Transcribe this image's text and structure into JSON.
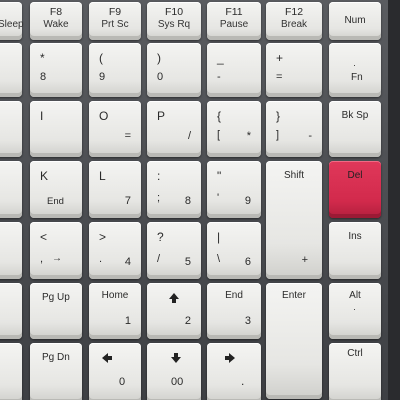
{
  "keys": {
    "f7": {
      "sub": "Sleep"
    },
    "f8": {
      "top": "F8",
      "sub": "Wake"
    },
    "f9": {
      "top": "F9",
      "sub": "Prt Sc"
    },
    "f10": {
      "top": "F10",
      "sub": "Sys Rq"
    },
    "f11": {
      "top": "F11",
      "sub": "Pause"
    },
    "f12": {
      "top": "F12",
      "sub": "Break"
    },
    "num": {
      "label": "Num"
    },
    "k8": {
      "shift": "*",
      "base": "8"
    },
    "k9": {
      "shift": "(",
      "base": "9"
    },
    "k0": {
      "shift": ")",
      "base": "0"
    },
    "minus": {
      "shift": "_",
      "base": "-"
    },
    "plus": {
      "shift": "+",
      "base": "="
    },
    "fn": {
      "label": "Fn"
    },
    "i": {
      "main": "I",
      "num": ""
    },
    "o": {
      "main": "O",
      "num": "="
    },
    "p": {
      "main": "P",
      "num": "/"
    },
    "lbracket": {
      "shift": "{",
      "base": "[",
      "num": "*"
    },
    "rbracket": {
      "shift": "}",
      "base": "]",
      "num": "-"
    },
    "bksp": {
      "label": "Bk Sp"
    },
    "k": {
      "main": "K",
      "sub": "End"
    },
    "l": {
      "main": "L",
      "num": "7"
    },
    "semicolon": {
      "shift": ":",
      "base": ";",
      "num": "8"
    },
    "quote": {
      "shift": "\"",
      "base": "'",
      "num": "9"
    },
    "shift": {
      "label": "Shift"
    },
    "del": {
      "label": "Del"
    },
    "comma": {
      "shift": "<",
      "base": ",",
      "num": "→"
    },
    "period": {
      "shift": ">",
      "base": ".",
      "num": "4"
    },
    "slash": {
      "shift": "?",
      "base": "/",
      "num": "5"
    },
    "backslash": {
      "shift": "|",
      "base": "\\",
      "num": "6"
    },
    "ins": {
      "label": "Ins"
    },
    "pgup": {
      "label": "Pg Up"
    },
    "home": {
      "label": "Home",
      "num": "1"
    },
    "up": {
      "num": "2"
    },
    "end": {
      "label": "End",
      "num": "3"
    },
    "enter": {
      "label": "Enter",
      "num": "+"
    },
    "alt": {
      "label": "Alt"
    },
    "pgdn": {
      "label": "Pg Dn"
    },
    "left": {
      "num": "0"
    },
    "down": {
      "num": "00"
    },
    "right": {
      "num": "."
    },
    "ctrl": {
      "label": "Ctrl"
    }
  },
  "colors": {
    "key": "#ececea",
    "accent_key": "#d8304f",
    "background": "#4a4c50"
  }
}
